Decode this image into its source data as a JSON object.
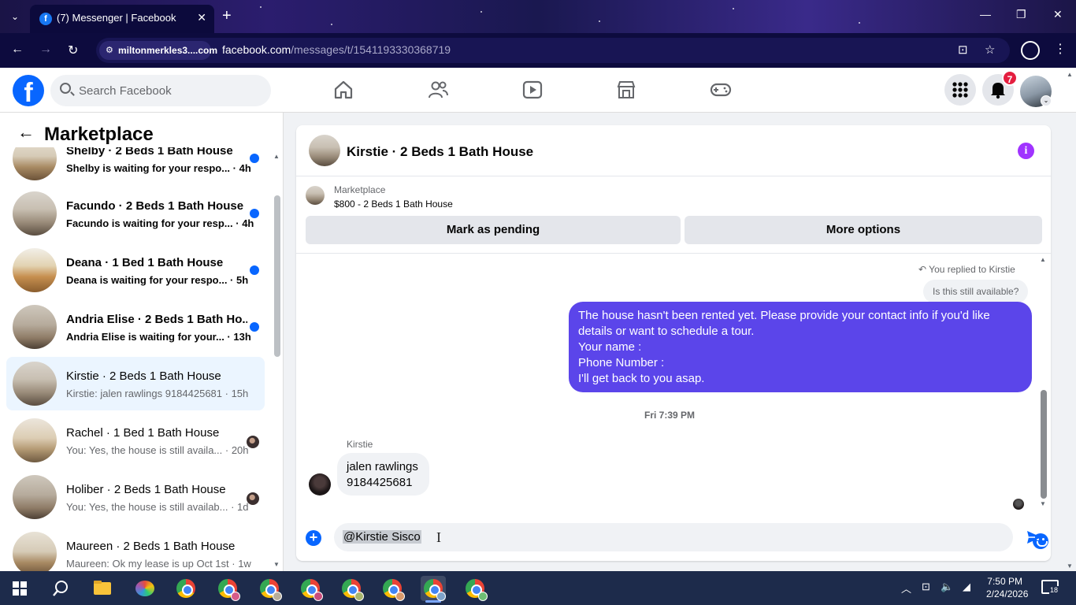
{
  "browser": {
    "tab_title": "(7) Messenger | Facebook",
    "tab_favicon": "f",
    "site_chip": "miltonmerkles3....com",
    "url_host": "facebook.com",
    "url_path": "/messages/t/1541193330368719"
  },
  "fb": {
    "logo": "f",
    "search_placeholder": "Search Facebook",
    "notification_count": "7",
    "nav_icons": [
      "home-icon",
      "friends-icon",
      "video-icon",
      "marketplace-icon",
      "gaming-icon"
    ]
  },
  "sidebar": {
    "title": "Marketplace",
    "conversations": [
      {
        "name": "Shelby · 2 Beds 1 Bath House",
        "snippet": "Shelby is waiting for your respo... · 4h",
        "unread": true
      },
      {
        "name": "Facundo · 2 Beds 1 Bath House",
        "snippet": "Facundo is waiting for your resp... · 4h",
        "unread": true
      },
      {
        "name": "Deana · 1 Bed 1 Bath House",
        "snippet": "Deana is waiting for your respo... · 5h",
        "unread": true
      },
      {
        "name": "Andria Elise · 2 Beds 1 Bath Ho...",
        "snippet": "Andria Elise is waiting for your... · 13h",
        "unread": true
      },
      {
        "name": "Kirstie · 2 Beds 1 Bath House",
        "snippet": "Kirstie: jalen rawlings 9184425681 · 15h",
        "unread": false,
        "active": true
      },
      {
        "name": "Rachel · 1 Bed 1 Bath House",
        "snippet": "You: Yes, the house is still availa... · 20h",
        "unread": false
      },
      {
        "name": "Holiber · 2 Beds 1 Bath House",
        "snippet": "You: Yes, the house is still availab... · 1d",
        "unread": false
      },
      {
        "name": "Maureen · 2 Beds 1 Bath House",
        "snippet": "Maureen: Ok my lease is up Oct 1st · 1w",
        "unread": false
      }
    ]
  },
  "chat": {
    "title": "Kirstie · 2 Beds 1 Bath House",
    "marketplace_label": "Marketplace",
    "listing": "$800 - 2 Beds 1 Bath House",
    "mark_pending": "Mark as pending",
    "more_options": "More options",
    "replied_to": "You replied to Kirstie",
    "quoted": "Is this still available?",
    "sent_lines": [
      "The house hasn't been rented yet. Please provide your contact info if you'd like",
      "details or want to schedule a tour.",
      "Your name :",
      "Phone Number :",
      "I'll get back to you asap."
    ],
    "timestamp": "Fri 7:39 PM",
    "sender": "Kirstie",
    "received_lines": [
      "jalen rawlings",
      "9184425681"
    ],
    "composer_value": "@Kirstie Sisco"
  },
  "taskbar": {
    "time": "7:50 PM",
    "date": "2/24/2026",
    "notifications": "18"
  },
  "colors": {
    "fb_blue": "#0866ff",
    "sent_bubble": "#5b45ea",
    "badge_red": "#e41e3f",
    "info_purple": "#a033ff"
  }
}
